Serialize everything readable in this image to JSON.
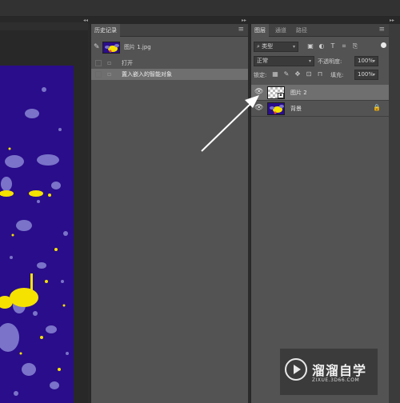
{
  "history_panel": {
    "tab": "历史记录",
    "snapshot_name": "图片 1.jpg",
    "items": [
      {
        "label": "打开",
        "selected": false
      },
      {
        "label": "置入嵌入的智能对象",
        "selected": true
      }
    ]
  },
  "layers_panel": {
    "tabs": [
      "图层",
      "通道",
      "路径"
    ],
    "filter_kind": "类型",
    "blend_mode": "正常",
    "opacity_label": "不透明度:",
    "opacity_value": "100%",
    "lock_label": "锁定:",
    "fill_label": "填充:",
    "fill_value": "100%",
    "layers": [
      {
        "name": "图片 2",
        "selected": true,
        "visible": true,
        "smart_object": true,
        "locked": false
      },
      {
        "name": "背景",
        "selected": false,
        "visible": true,
        "smart_object": false,
        "locked": true
      }
    ]
  },
  "watermark": {
    "title": "溜溜自学",
    "url": "ZIXUE.3D66.COM"
  },
  "colors": {
    "panel_bg": "#535353",
    "selection": "#6f6f6f",
    "canvas_purple": "#2a0d8a",
    "splash_yellow": "#f5e200",
    "splash_lavender": "#7a73c9"
  },
  "icons": {
    "eye": "eye-icon",
    "lock": "lock-icon",
    "menu": "panel-menu-icon"
  }
}
